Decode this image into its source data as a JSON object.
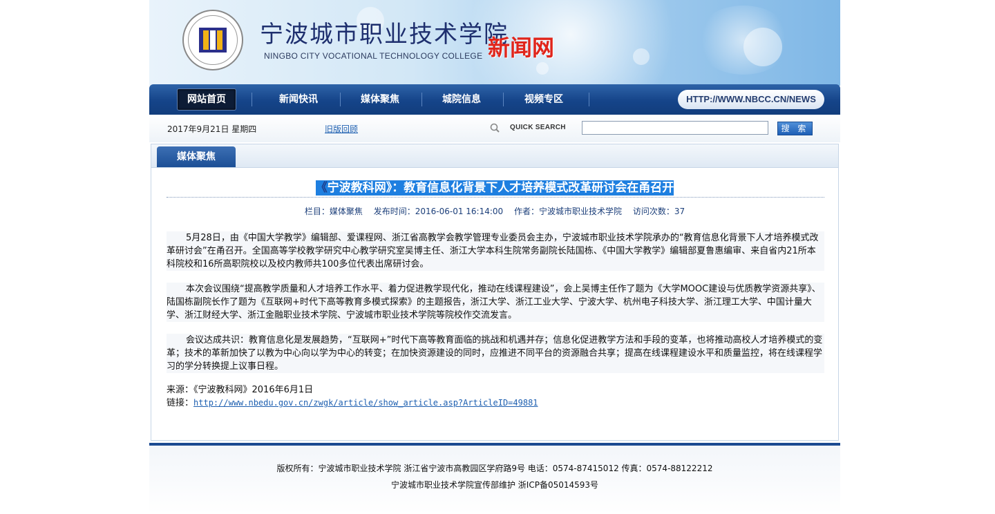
{
  "header": {
    "school_name_cn": "宁波城市职业技术学院",
    "school_name_en": "NINGBO CITY VOCATIONAL TECHNOLOGY COLLEGE",
    "site_title": "新闻网"
  },
  "nav": {
    "items": [
      {
        "label": "网站首页",
        "active": true
      },
      {
        "label": "新闻快讯"
      },
      {
        "label": "媒体聚焦"
      },
      {
        "label": "城院信息"
      },
      {
        "label": "视频专区"
      }
    ],
    "url_badge": "HTTP://WWW.NBCC.CN/NEWS"
  },
  "infobar": {
    "date": "2017年9月21日 星期四",
    "old_version": "旧版回顾",
    "quick_search_label": "QUICK SEARCH",
    "search_value": "",
    "search_button": "搜 索"
  },
  "panel": {
    "tab_label": "媒体聚焦"
  },
  "article": {
    "title_prefix": "《",
    "title_rest": "宁波教科网》：教育信息化背景下人才培养模式改革研讨会在甬召开",
    "meta": {
      "column": "栏目：媒体聚焦",
      "published": "发布时间：2016-06-01 16:14:00",
      "author": "作者：宁波城市职业技术学院",
      "visits": "访问次数：37"
    },
    "paragraphs": [
      "5月28日，由《中国大学教学》编辑部、爱课程网、浙江省高教学会教学管理专业委员会主办，宁波城市职业技术学院承办的“教育信息化背景下人才培养模式改革研讨会”在甬召开。全国高等学校教学研究中心教学研究室吴博主任、浙江大学本科生院常务副院长陆国栋、《中国大学教学》编辑部夏鲁惠编审、来自省内21所本科院校和16所高职院校以及校内教师共100多位代表出席研讨会。",
      "本次会议围绕“提高教学质量和人才培养工作水平、着力促进教学现代化，推动在线课程建设”，会上吴博主任作了题为《大学MOOC建设与优质教学资源共享》、陆国栋副院长作了题为《互联网+时代下高等教育多模式探索》的主题报告，浙江大学、浙江工业大学、宁波大学、杭州电子科技大学、浙江理工大学、中国计量大学、浙江财经大学、浙江金融职业技术学院、宁波城市职业技术学院等院校作交流发言。",
      "会议达成共识：教育信息化是发展趋势，“互联网+”时代下高等教育面临的挑战和机遇并存；信息化促进教学方法和手段的变革，也将推动高校人才培养模式的变革；技术的革新加快了以教为中心向以学为中心的转变；在加快资源建设的同时，应推进不同平台的资源融合共享；提高在线课程建设水平和质量监控，将在线课程学习的学分转换提上议事日程。"
    ],
    "source_label": "来源：《宁波教科网》2016年6月1日",
    "link_label": "链接：",
    "link_url": "http://www.nbedu.gov.cn/zwgk/article/show_article.asp?ArticleID=49881"
  },
  "footer": {
    "line1": "版权所有：宁波城市职业技术学院 浙江省宁波市高教园区学府路9号 电话：0574-87415012 传真：0574-88122212",
    "line2": "宁波城市职业技术学院宣传部维护 浙ICP备05014593号"
  },
  "colors": {
    "nav_blue": "#154489",
    "title_blue": "#1f3f8c",
    "site_title_red": "#e0251b",
    "link_blue": "#1d5fb0"
  }
}
